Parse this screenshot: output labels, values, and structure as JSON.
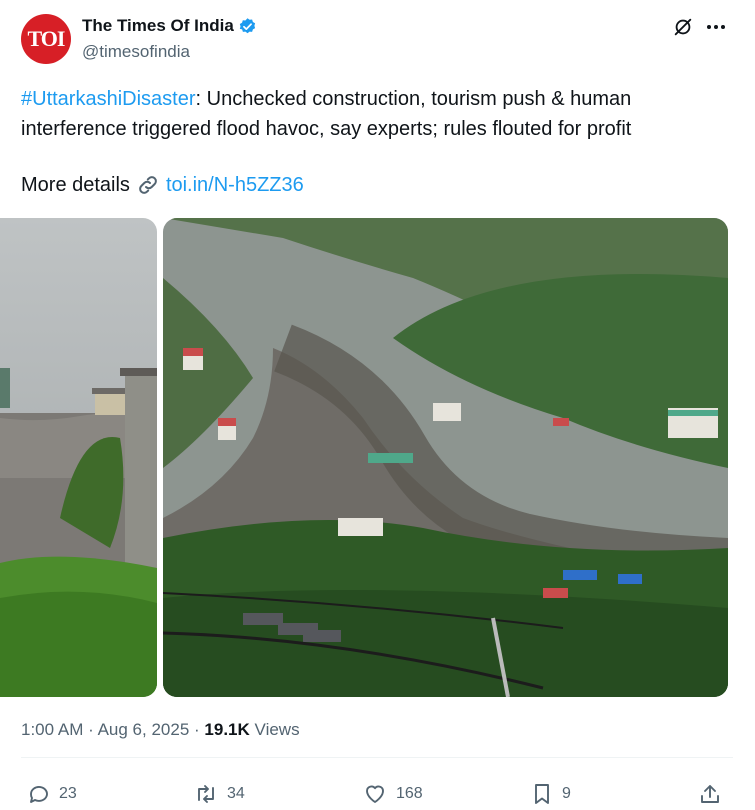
{
  "author": {
    "name": "The Times Of India",
    "handle": "@timesofindia",
    "avatar_text": "TOI",
    "verified": true
  },
  "post": {
    "hashtag": "#UttarkashiDisaster",
    "body": ": Unchecked construction, tourism push & human interference triggered flood havoc, say experts; rules flouted for profit",
    "details_label": "More details",
    "link_text": "toi.in/N-h5ZZ36"
  },
  "meta": {
    "time": "1:00 AM",
    "date": "Aug 6, 2025",
    "views_count": "19.1K",
    "views_label": "Views"
  },
  "actions": {
    "replies": "23",
    "reposts": "34",
    "likes": "168",
    "bookmarks": "9"
  },
  "icons": [
    "verified-badge-icon",
    "grok-icon",
    "more-icon",
    "link-icon",
    "reply-icon",
    "repost-icon",
    "like-icon",
    "bookmark-icon",
    "share-icon"
  ],
  "colors": {
    "accent": "#1d9bf0",
    "brand_red": "#d71f26",
    "muted": "#536471"
  }
}
